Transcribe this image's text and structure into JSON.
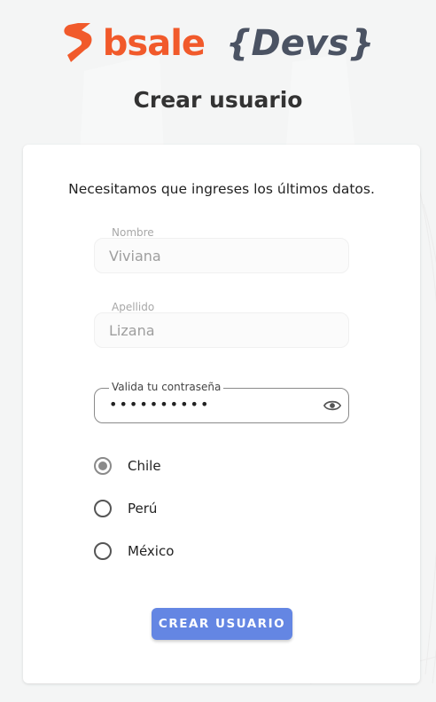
{
  "brand": {
    "name": "bsale",
    "suffix": "{Devs}",
    "brand_color": "#f15a2b",
    "suffix_color": "#4b5363"
  },
  "page": {
    "title": "Crear usuario"
  },
  "form": {
    "intro": "Necesitamos que ingreses los últimos datos.",
    "fields": [
      {
        "label": "Nombre",
        "value": "Viviana",
        "disabled": true
      },
      {
        "label": "Apellido",
        "value": "Lizana",
        "disabled": true
      },
      {
        "label": "Valida tu contraseña",
        "value": "••••••••••",
        "type": "password",
        "icon": "eye-icon"
      }
    ],
    "country_options": [
      {
        "label": "Chile",
        "checked": true
      },
      {
        "label": "Perú",
        "checked": false
      },
      {
        "label": "México",
        "checked": false
      }
    ],
    "submit_label": "CREAR USUARIO",
    "submit_color": "#6486e3"
  }
}
